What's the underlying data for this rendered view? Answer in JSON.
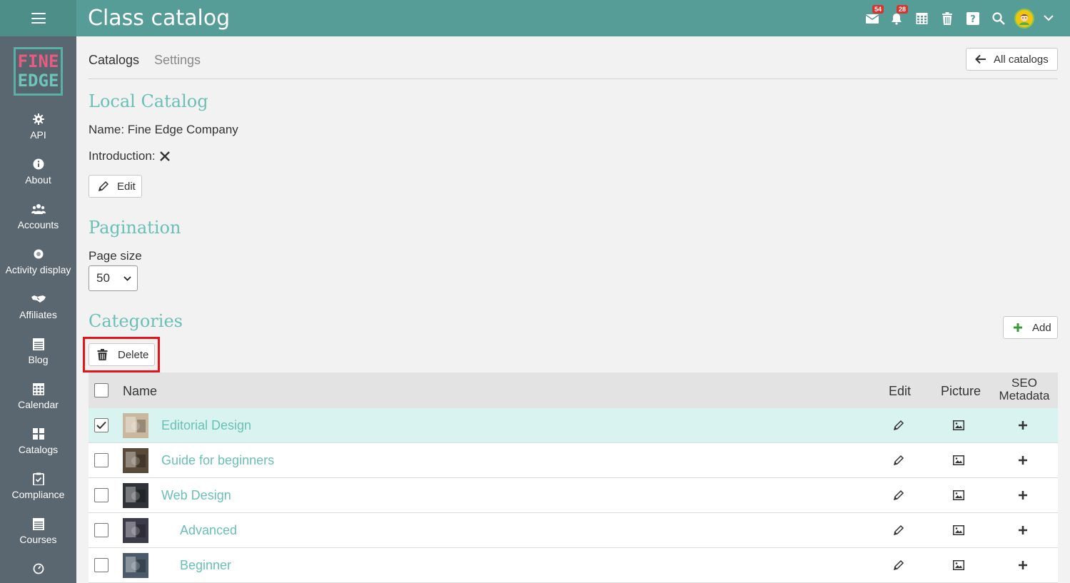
{
  "header": {
    "title": "Class catalog",
    "mail_badge": "54",
    "notif_badge": "28"
  },
  "sidebar": {
    "logo_line1": "FINE",
    "logo_line2": "EDGE",
    "items": [
      {
        "label": "API",
        "icon": "gear-icon"
      },
      {
        "label": "About",
        "icon": "info-icon"
      },
      {
        "label": "Accounts",
        "icon": "users-icon"
      },
      {
        "label": "Activity display",
        "icon": "dot-circle-icon"
      },
      {
        "label": "Affiliates",
        "icon": "handshake-icon"
      },
      {
        "label": "Blog",
        "icon": "list-icon"
      },
      {
        "label": "Calendar",
        "icon": "calendar-icon"
      },
      {
        "label": "Catalogs",
        "icon": "grid-icon"
      },
      {
        "label": "Compliance",
        "icon": "clipboard-check-icon"
      },
      {
        "label": "Courses",
        "icon": "list-icon"
      }
    ]
  },
  "tabs": {
    "catalogs": "Catalogs",
    "settings": "Settings"
  },
  "all_catalogs_label": "All catalogs",
  "local_catalog": {
    "title": "Local Catalog",
    "name_line": "Name: Fine Edge Company",
    "intro_label": "Introduction:",
    "edit_label": "Edit"
  },
  "pagination": {
    "title": "Pagination",
    "page_size_label": "Page size",
    "page_size_value": "50"
  },
  "categories": {
    "title": "Categories",
    "add_label": "Add",
    "delete_label": "Delete",
    "columns": {
      "name": "Name",
      "edit": "Edit",
      "picture": "Picture",
      "seo_line1": "SEO",
      "seo_line2": "Metadata"
    },
    "rows": [
      {
        "name": "Editorial Design",
        "checked": true,
        "indent": false,
        "thumb_color": "#c9b7a0"
      },
      {
        "name": "Guide for beginners",
        "checked": false,
        "indent": false,
        "thumb_color": "#5a4a3a"
      },
      {
        "name": "Web Design",
        "checked": false,
        "indent": false,
        "thumb_color": "#2f3337"
      },
      {
        "name": "Advanced",
        "checked": false,
        "indent": true,
        "thumb_color": "#3c3b4a"
      },
      {
        "name": "Beginner",
        "checked": false,
        "indent": true,
        "thumb_color": "#4a5a68"
      }
    ]
  },
  "colors": {
    "topbar": "#579d97",
    "sidebar": "#5b6770",
    "accent_text": "#6ac0b6",
    "highlight_red": "#e3151b",
    "selected_row": "#d9f3f1"
  }
}
